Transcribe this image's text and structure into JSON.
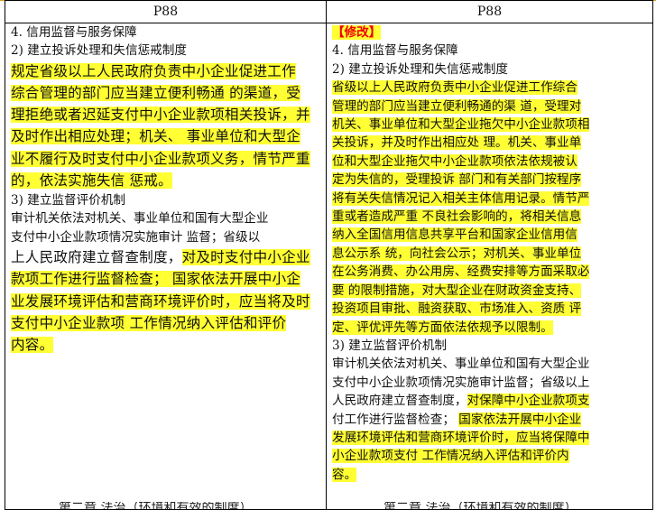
{
  "header": {
    "left": "P88",
    "right": "P88"
  },
  "left": {
    "lines": [
      {
        "t": "4. 信用监督与服务保障",
        "hl": false,
        "big": false
      },
      {
        "t": "2) 建立投诉处理和失信惩戒制度",
        "hl": false,
        "big": false
      },
      {
        "t": "规定省级以上人民政府负责中小企业促进工作",
        "hl": true,
        "big": true
      },
      {
        "t": "综合管理的部门应当建立便利畅通 的渠道，受",
        "hl": true,
        "big": true
      },
      {
        "t": "理拒绝或者迟延支付中小企业款项相关投诉，并",
        "hl": true,
        "big": true
      },
      {
        "t": "及时作出相应处理；机关、 事业单位和大型企",
        "hl": true,
        "big": true
      },
      {
        "t": "业不履行及时支付中小企业款项义务，情节严重",
        "hl": true,
        "big": true
      },
      {
        "t": "的，依法实施失信 惩戒。",
        "hl": true,
        "big": true
      },
      {
        "t": "3) 建立监督评价机制",
        "hl": false,
        "big": false
      },
      {
        "t": "审计机关依法对机关、事业单位和国有大型企业",
        "hl": false,
        "big": false
      },
      {
        "t": "支付中小企业款项情况实施审计  监督；省级以",
        "hl": false,
        "big": false
      },
      {
        "t": "上人民政府建立督查制度，对及时支付中小企业",
        "hl": "partial",
        "split": 12,
        "big": true
      },
      {
        "t": "款项工作进行监督检查；  国家依法开展中小企",
        "hl": true,
        "big": true
      },
      {
        "t": "业发展环境评估和营商环境评价时，应当将及时",
        "hl": true,
        "big": true
      },
      {
        "t": "支付中小企业款项   工作情况纳入评估和评价",
        "hl": true,
        "big": true
      },
      {
        "t": "内容。",
        "hl": true,
        "big": true
      }
    ]
  },
  "right": {
    "tag": "【修改】",
    "lines": [
      {
        "t": "4.  信用监督与服务保障",
        "hl": false,
        "big": false
      },
      {
        "t": "2) 建立投诉处理和失信惩戒制度",
        "hl": false,
        "big": false
      },
      {
        "t": "省级以上人民政府负责中小企业促进工作综合",
        "hl": true,
        "big": false
      },
      {
        "t": "管理的部门应当建立便利畅通的渠 道，受理对",
        "hl": true,
        "big": false
      },
      {
        "t": "机关、事业单位和大型企业拖欠中小企业款项相",
        "hl": true,
        "big": false
      },
      {
        "t": "关投诉，并及时作出相应处 理。机关、事业单",
        "hl": true,
        "big": false
      },
      {
        "t": "位和大型企业拖欠中小企业款项依法依规被认",
        "hl": true,
        "big": false
      },
      {
        "t": "定为失信的，受理投诉  部门和有关部门按程序",
        "hl": true,
        "big": false
      },
      {
        "t": "将有关失信情况记入相关主体信用记录。情节严",
        "hl": true,
        "big": false
      },
      {
        "t": "重或者造成严重  不良社会影响的，将相关信息",
        "hl": true,
        "big": false
      },
      {
        "t": "纳入全国信用信息共享平台和国家企业信用信",
        "hl": true,
        "big": false
      },
      {
        "t": "息公示系 统，向社会公示；对机关、事业单位",
        "hl": true,
        "big": false
      },
      {
        "t": "在公务消费、办公用房、经费安排等方面采取必",
        "hl": true,
        "big": false
      },
      {
        "t": "要 的限制措施，对大型企业在财政资金支持、",
        "hl": true,
        "big": false
      },
      {
        "t": "投资项目审批、融资获取、市场准入、资质 评",
        "hl": true,
        "big": false
      },
      {
        "t": "定、评优评先等方面依法依规予以限制。",
        "hl": true,
        "big": false
      },
      {
        "t": "3) 建立监督评价机制",
        "hl": false,
        "big": false
      },
      {
        "t": "审计机关依法对机关、事业单位和国有大型企业",
        "hl": false,
        "big": false
      },
      {
        "t": "支付中小企业款项情况实施审计监督；省级以上",
        "hl": false,
        "big": false
      },
      {
        "t": "人民政府建立督查制度，对保障中小企业款项支",
        "hl": "partial",
        "split": 11,
        "big": false
      },
      {
        "t": "付工作进行监督检查；  国家依法开展中小企业",
        "hl": "partial",
        "split": 11,
        "big": false
      },
      {
        "t": "发展环境评估和营商环境评价时，应当将保障中",
        "hl": true,
        "big": false
      },
      {
        "t": "小企业款项支付   工作情况纳入评估和评价内",
        "hl": true,
        "big": false
      },
      {
        "t": "容。",
        "hl": true,
        "big": false
      }
    ]
  },
  "footer": {
    "left": "第二章  法治（环境和有效的制度）",
    "right": "第二章  法治（环境和有效的制度）"
  },
  "colors": {
    "highlight": "#ffff33",
    "tag": "#ee0000",
    "topRule": "#d4a017"
  }
}
